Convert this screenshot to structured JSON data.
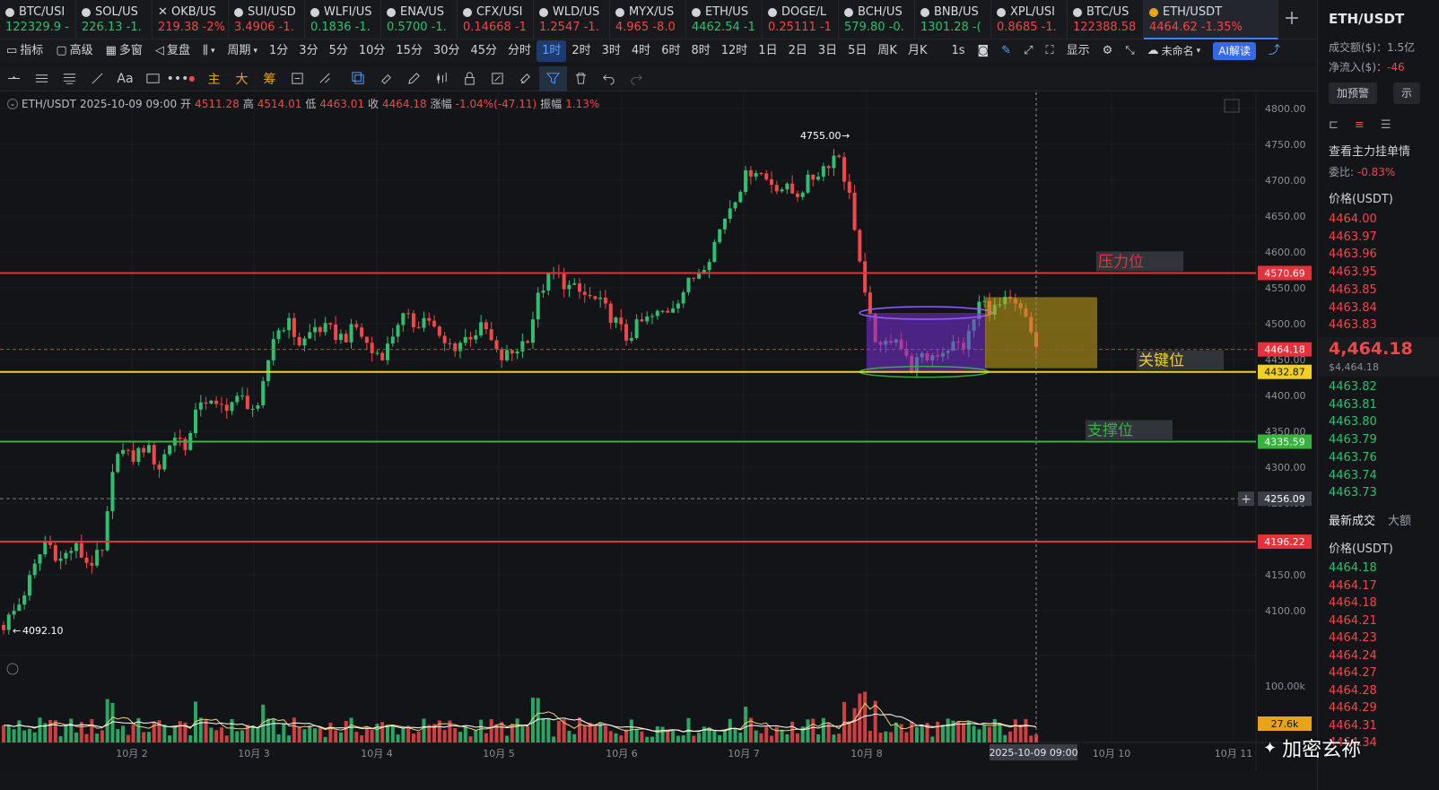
{
  "tickers": [
    {
      "sym": "BTC/USI",
      "price": "122329.9",
      "chg": "-",
      "dir": "up"
    },
    {
      "sym": "SOL/US",
      "price": "226.13",
      "chg": "-1.",
      "dir": "up"
    },
    {
      "sym": "OKB/US",
      "price": "219.38",
      "chg": "-2%",
      "dir": "dn"
    },
    {
      "sym": "SUI/USD",
      "price": "3.4906",
      "chg": "-1.",
      "dir": "dn"
    },
    {
      "sym": "WLFI/US",
      "price": "0.1836",
      "chg": "-1.",
      "dir": "up"
    },
    {
      "sym": "ENA/US",
      "price": "0.5700",
      "chg": "-1.",
      "dir": "up"
    },
    {
      "sym": "CFX/USI",
      "price": "0.14668",
      "chg": "-1",
      "dir": "dn"
    },
    {
      "sym": "WLD/US",
      "price": "1.2547",
      "chg": "-1.",
      "dir": "dn"
    },
    {
      "sym": "MYX/US",
      "price": "4.965",
      "chg": "-8.0",
      "dir": "dn"
    },
    {
      "sym": "ETH/US",
      "price": "4462.54",
      "chg": "-1",
      "dir": "up"
    },
    {
      "sym": "DOGE/L",
      "price": "0.25111",
      "chg": "-1",
      "dir": "dn"
    },
    {
      "sym": "BCH/US",
      "price": "579.80",
      "chg": "-0.",
      "dir": "up"
    },
    {
      "sym": "BNB/US",
      "price": "1301.28",
      "chg": "-(",
      "dir": "up"
    },
    {
      "sym": "XPL/USI",
      "price": "0.8685",
      "chg": "-1.",
      "dir": "dn"
    },
    {
      "sym": "BTC/US",
      "price": "122388.58",
      "chg": "",
      "dir": "dn"
    }
  ],
  "active_ticker": {
    "sym": "ETH/USDT",
    "price": "4464.62",
    "chg": "-1.35%"
  },
  "toolbar": {
    "indicators": "指标",
    "advanced": "高级",
    "multi": "多窗",
    "replay": "复盘",
    "period": "周期",
    "timeframes": [
      "1分",
      "3分",
      "5分",
      "10分",
      "15分",
      "30分",
      "45分",
      "分时",
      "1时",
      "2时",
      "3时",
      "4时",
      "6时",
      "8时",
      "12时",
      "1日",
      "2日",
      "3日",
      "5日",
      "周K",
      "月K"
    ],
    "selected_tf": "1时",
    "sec": "1s",
    "display": "显示",
    "unnamed": "未命名",
    "ai": "AI解读"
  },
  "drawtools": {
    "main": "主",
    "big": "大",
    "chip": "筹"
  },
  "ohlc": {
    "pair": "ETH/USDT",
    "time": "2025-10-09 09:00",
    "open_l": "开",
    "open": "4511.28",
    "high_l": "高",
    "high": "4514.01",
    "low_l": "低",
    "low": "4463.01",
    "close_l": "收",
    "close": "4464.18",
    "chg_l": "涨幅",
    "chg": "-1.04%(-47.11)",
    "amp_l": "振幅",
    "amp": "1.13%"
  },
  "chart_data": {
    "type": "candlestick",
    "y_range": [
      4060,
      4810
    ],
    "y_ticks": [
      "4800.00",
      "4750.00",
      "4700.00",
      "4650.00",
      "4600.00",
      "4550.00",
      "4500.00",
      "4450.00",
      "4400.00",
      "4350.00",
      "4300.00",
      "4250.00",
      "4200.00",
      "4150.00",
      "4100.00"
    ],
    "x_ticks": [
      "10月 2",
      "10月 3",
      "10月 4",
      "10月 5",
      "10月 6",
      "10月 7",
      "10月 8",
      "10月 10",
      "10月 11"
    ],
    "cursor_time": "2025-10-09 09:00",
    "high_mark": "4755.00",
    "low_mark": "4092.10",
    "series": [
      4080,
      4105,
      4150,
      4200,
      4170,
      4190,
      4165,
      4180,
      4330,
      4310,
      4330,
      4300,
      4345,
      4330,
      4400,
      4380,
      4390,
      4395,
      4375,
      4480,
      4505,
      4470,
      4495,
      4490,
      4480,
      4495,
      4460,
      4460,
      4510,
      4500,
      4510,
      4470,
      4470,
      4485,
      4495,
      4450,
      4460,
      4480,
      4550,
      4570,
      4550,
      4540,
      4530,
      4510,
      4480,
      4500,
      4510,
      4520,
      4545,
      4570,
      4600,
      4650,
      4690,
      4720,
      4700,
      4690,
      4680,
      4700,
      4720,
      4740,
      4660,
      4520,
      4460,
      4490,
      4440,
      4450,
      4460,
      4470,
      4470,
      4530,
      4520,
      4530,
      4515,
      4470
    ],
    "levels": [
      {
        "value": 4570.69,
        "label": "4570.69",
        "text": "压力位",
        "color": "#e3323a"
      },
      {
        "value": 4464.18,
        "label": "4464.18",
        "text": "",
        "color": "#e3323a",
        "dashed": true
      },
      {
        "value": 4432.87,
        "label": "4432.87",
        "text": "关键位",
        "color": "#f0d020"
      },
      {
        "value": 4335.59,
        "label": "4335.59",
        "text": "支撑位",
        "color": "#35b33a"
      },
      {
        "value": 4256.09,
        "label": "4256.09",
        "text": "",
        "color": "#7a7e86",
        "dashed": true
      },
      {
        "value": 4196.22,
        "label": "4196.22",
        "text": "",
        "color": "#e3323a"
      }
    ],
    "volume": {
      "tick": "100.00k",
      "last": "27.6k"
    }
  },
  "side": {
    "title": "ETH/USDT",
    "turnover_l": "成交额($)：",
    "turnover": "1.5亿",
    "inflow_l": "净流入($)：",
    "inflow": "-46",
    "alert": "加预警",
    "alert2": "示",
    "section": "查看主力挂单情",
    "ratio_l": "委比:",
    "ratio": "-0.83%",
    "price_hdr": "价格(USDT)",
    "asks": [
      "4464.00",
      "4463.97",
      "4463.96",
      "4463.95",
      "4463.85",
      "4463.84",
      "4463.83"
    ],
    "last": "4,464.18",
    "last_usd": "$4,464.18",
    "bids": [
      "4463.82",
      "4463.81",
      "4463.80",
      "4463.79",
      "4463.76",
      "4463.74",
      "4463.73"
    ],
    "trades_tab": "最新成交",
    "trades_tab2": "大额",
    "trades_hdr": "价格(USDT)",
    "trades": [
      [
        "4464.18",
        "up"
      ],
      [
        "4464.17",
        "dn"
      ],
      [
        "4464.18",
        "dn"
      ],
      [
        "4464.21",
        "dn"
      ],
      [
        "4464.23",
        "dn"
      ],
      [
        "4464.24",
        "dn"
      ],
      [
        "4464.27",
        "dn"
      ],
      [
        "4464.28",
        "dn"
      ],
      [
        "4464.29",
        "dn"
      ],
      [
        "4464.31",
        "dn"
      ],
      [
        "4464.34",
        "dn"
      ]
    ]
  },
  "watermark": "加密玄祢"
}
